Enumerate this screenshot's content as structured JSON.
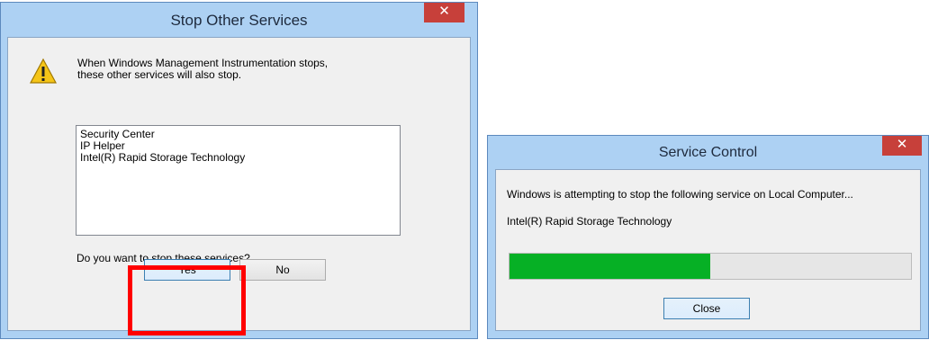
{
  "dialog1": {
    "title": "Stop Other Services",
    "close_glyph": "✕",
    "message_line1": "When Windows Management Instrumentation stops,",
    "message_line2": "these other services will also stop.",
    "services": [
      "Security Center",
      "IP Helper",
      "Intel(R) Rapid Storage Technology"
    ],
    "question": "Do you want to stop these services?",
    "yes_label": "Yes",
    "no_label": "No",
    "icon": "warning-icon"
  },
  "dialog2": {
    "title": "Service Control",
    "close_glyph": "✕",
    "status_message": "Windows is attempting to stop the following service on Local Computer...",
    "service_name": "Intel(R) Rapid Storage Technology",
    "progress_fraction": 0.5,
    "close_label": "Close"
  },
  "colors": {
    "frame": "#add1f3",
    "close_button": "#c7403a",
    "progress_fill": "#06b025",
    "highlight": "#ff0000"
  }
}
